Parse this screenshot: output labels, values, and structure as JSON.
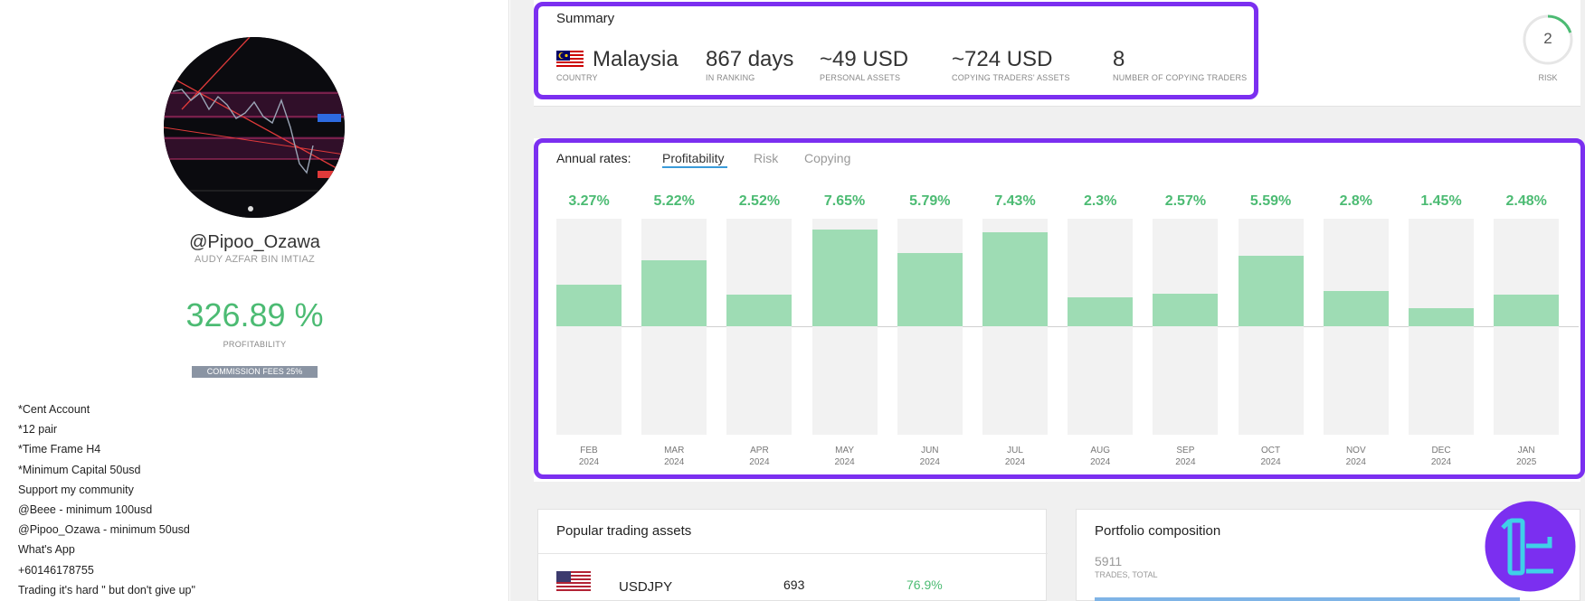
{
  "profile": {
    "username": "@Pipoo_Ozawa",
    "full_name": "AUDY AZFAR BIN IMTIAZ",
    "profitability_value": "326.89 %",
    "profitability_label": "PROFITABILITY",
    "commission": "COMMISSION FEES 25%",
    "description": [
      "*Cent Account",
      "*12 pair",
      "*Time Frame H4",
      "*Minimum Capital 50usd",
      "Support my community",
      "@Beee - minimum 100usd",
      "@Pipoo_Ozawa - minimum 50usd",
      "What's App",
      "+60146178755",
      "Trading it's hard \" but don't give up\""
    ]
  },
  "summary": {
    "title": "Summary",
    "country": {
      "value": "Malaysia",
      "label": "COUNTRY"
    },
    "ranking": {
      "value": "867 days",
      "label": "IN RANKING"
    },
    "personal_assets": {
      "value": "~49 USD",
      "label": "PERSONAL ASSETS"
    },
    "copying_assets": {
      "value": "~724 USD",
      "label": "COPYING TRADERS' ASSETS"
    },
    "copying_traders": {
      "value": "8",
      "label": "NUMBER OF COPYING TRADERS"
    }
  },
  "risk": {
    "value": "2",
    "label": "RISK",
    "level_fraction": 0.2
  },
  "annual": {
    "heading": "Annual rates:",
    "tabs": [
      "Profitability",
      "Risk",
      "Copying"
    ],
    "active_tab": "Profitability"
  },
  "chart_data": {
    "type": "bar",
    "title": "",
    "categories": [
      "FEB 2024",
      "MAR 2024",
      "APR 2024",
      "MAY 2024",
      "JUN 2024",
      "JUL 2024",
      "AUG 2024",
      "SEP 2024",
      "OCT 2024",
      "NOV 2024",
      "DEC 2024",
      "JAN 2025"
    ],
    "month_labels": [
      "FEB",
      "MAR",
      "APR",
      "MAY",
      "JUN",
      "JUL",
      "AUG",
      "SEP",
      "OCT",
      "NOV",
      "DEC",
      "JAN"
    ],
    "year_labels": [
      "2024",
      "2024",
      "2024",
      "2024",
      "2024",
      "2024",
      "2024",
      "2024",
      "2024",
      "2024",
      "2024",
      "2025"
    ],
    "values": [
      3.27,
      5.22,
      2.52,
      7.65,
      5.79,
      7.43,
      2.3,
      2.57,
      5.59,
      2.8,
      1.45,
      2.48
    ],
    "value_labels": [
      "3.27%",
      "5.22%",
      "2.52%",
      "7.65%",
      "5.79%",
      "7.43%",
      "2.3%",
      "2.57%",
      "5.59%",
      "2.8%",
      "1.45%",
      "2.48%"
    ],
    "ylim": [
      -8.5,
      8.5
    ],
    "colors": {
      "bar": "#9edcb4",
      "label": "#4cbb73",
      "track": "#f2f2f2"
    }
  },
  "assets": {
    "title": "Popular trading assets",
    "rows": [
      {
        "symbol": "USDJPY",
        "trades": "693",
        "profitable": "76.9%"
      }
    ]
  },
  "portfolio": {
    "title": "Portfolio composition",
    "total_value": "5911",
    "total_label": "TRADES, TOTAL"
  },
  "colors": {
    "accent_highlight": "#7b2ff0",
    "positive": "#4cbb73",
    "tab_underline": "#3a9bd9"
  }
}
